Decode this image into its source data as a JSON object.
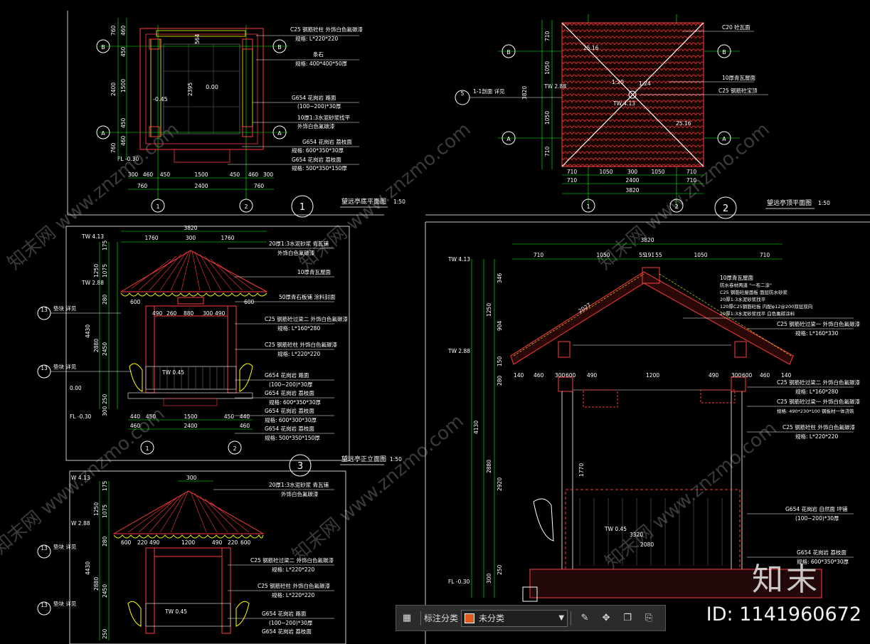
{
  "drawings": {
    "plan_base": {
      "title": "望远亭底平面图",
      "scale": "1:50",
      "number": "1",
      "grid_rows": [
        "B",
        "A"
      ],
      "grid_cols": [
        "1",
        "2"
      ],
      "dims_bottom_1": [
        "300",
        "460",
        "450",
        "1500",
        "450",
        "460",
        "300"
      ],
      "dims_bottom_2": [
        "760",
        "2400",
        "760"
      ],
      "dims_left": [
        "760",
        "460",
        "450",
        "1500",
        "2400",
        "450",
        "460",
        "760"
      ],
      "center_dims": [
        "2395",
        "564"
      ],
      "level_main": "0.00",
      "level_side": "-0.45",
      "level_fl": "FL -0.30",
      "notes": [
        "C25 钢筋砼柱  外饰白色氟碳漆",
        "规格: L*220*220",
        "条石",
        "规格: 400*400*50厚",
        "G654 花岗岩  路面",
        "(100~200)*30厚",
        "10厚1:3水泥砂浆找平",
        "外饰白色氟碳漆",
        "G654 花岗岩 荔枝面",
        "规格: 600*350*30厚",
        "G654 花岗岩 荔枝面",
        "规格: 500*350*150厚"
      ]
    },
    "plan_roof": {
      "title": "望远亭顶平面图",
      "scale": "1:50",
      "number": "2",
      "dims_bottom_1": [
        "710",
        "1050",
        "300",
        "1050",
        "710"
      ],
      "dims_bottom_2": [
        "710",
        "2400",
        "710"
      ],
      "dims_bottom_3": [
        "3820"
      ],
      "dims_left": [
        "710",
        "1050",
        "3820",
        "1050",
        "710"
      ],
      "level_tw_1": "TW 2.88",
      "level_tw_2": "TW 4.13",
      "diag_labels": [
        "25.16",
        "1:20",
        "1:24",
        "25.16"
      ],
      "notes": [
        "C20 砼瓦面",
        "10厚青瓦屋面",
        "C25 钢筋砼宝顶"
      ],
      "section_ref": "5",
      "section_ref_text": "1-1剖面  详见"
    },
    "elev_front": {
      "title": "望远亭正立面图",
      "scale": "1:50",
      "number": "3",
      "dims_top": [
        "3820",
        "1760",
        "300",
        "1760"
      ],
      "dims_inner": [
        "600",
        "490",
        "260",
        "880",
        "300",
        "490",
        "600"
      ],
      "dims_left": [
        "175",
        "1250",
        "1075",
        "280",
        "4430",
        "2880",
        "2450",
        "250",
        "300"
      ],
      "levels": [
        "TW 4.13",
        "TW 2.88",
        "0.00",
        "FL -0.30",
        "TW 0.45"
      ],
      "dims_bottom_1": [
        "440",
        "450",
        "1500",
        "450",
        "440"
      ],
      "dims_bottom_2": [
        "460",
        "2400",
        "460"
      ],
      "notes": [
        "20厚1:3水泥砂浆  青瓦铺",
        "外饰白色氟碳漆",
        "10厚青瓦屋面",
        "50厚青石板铺  涂料封面",
        "C25 钢筋砼过梁二  外饰白色氟碳漆",
        "规格: L*160*280",
        "C25 钢筋砼柱  外饰白色氟碳漆",
        "规格: L*220*220",
        "G654 花岗岩  路面",
        "(100~200)*30厚",
        "G654 花岗岩 荔枝面",
        "规格: 600*350*30厚",
        "G654 花岗岩 荔枝面",
        "规格: 600*300*30厚",
        "G654 花岗岩 荔枝面",
        "规格: 500*350*150厚"
      ],
      "ref_labels": [
        "13",
        "13"
      ],
      "ref_text": [
        "垫块 详见",
        "垫块 详见"
      ]
    },
    "elev_side": {
      "dims_top": [
        "300"
      ],
      "dims_inner": [
        "600",
        "220",
        "490",
        "1200",
        "490",
        "220",
        "600"
      ],
      "dims_left": [
        "175",
        "1250",
        "1075",
        "280",
        "4430",
        "2880",
        "2450",
        "250"
      ],
      "levels": [
        "W 4.13",
        "W 2.88",
        "TW 0.45"
      ],
      "notes": [
        "20厚1:3水泥砂浆  青瓦铺",
        "外饰白色氟碳漆",
        "C25 钢筋砼过梁二  外饰白色氟碳漆",
        "规格: L*220*220",
        "C25 钢筋砼柱  外饰白色氟碳漆",
        "规格: L*220*220",
        "G654 花岗岩  路面",
        "(100~200)*30厚",
        "G654 花岗岩 荔枝面"
      ]
    },
    "section": {
      "dims_top_1": [
        "3820"
      ],
      "dims_top_2": [
        "710",
        "1050",
        "55",
        "191",
        "55",
        "1050",
        "710"
      ],
      "dims_mid": [
        "140",
        "460",
        "300",
        "600",
        "490",
        "1200",
        "490",
        "300",
        "600",
        "460",
        "140"
      ],
      "dims_left": [
        "346",
        "1250",
        "904",
        "150",
        "280",
        "4130",
        "2880",
        "2920",
        "1770",
        "300",
        "250"
      ],
      "levels": [
        "TW 4.13",
        "TW 2.88",
        "FL -0.30",
        "TW 0.45"
      ],
      "inner_dims": [
        "3320",
        "2080",
        "2027"
      ],
      "notes": [
        "10厚青瓦屋面",
        "防水卷材两道 \"一布二涂\"",
        "C25 钢筋砼屋面板 面层防水砂浆",
        "20厚1:3水泥砂浆找平",
        "120厚C25钢筋砼板  内配φ12@200双层双向",
        "20厚1:3水泥砂浆找平  白色氟碳涂料",
        "C25 钢筋砼过梁一  外饰白色氟碳漆",
        "规格: L*160*330",
        "C25 钢筋砼过梁二  外饰白色氟碳漆",
        "规格: L*160*280",
        "C25 钢筋砼过梁一  外饰白色氟碳漆",
        "规格: 490*230*100 钢板材一体浇筑",
        "C25 钢筋砼柱  外饰白色氟碳漆",
        "规格: L*220*220",
        "G654 花岗岩 自然面  坪铺",
        "(100~200)*30厚",
        "G654 花岗岩 荔枝面",
        "规格: 600*350*30厚"
      ]
    }
  },
  "watermark": "知末网 www.znzmo.com",
  "toolbar": {
    "label": "标注分类",
    "selected": "未分类",
    "swatch_color": "#e05a1c",
    "icons": [
      "grid-icon",
      "edit-icon",
      "move-icon",
      "copy-icon",
      "paste-icon"
    ]
  },
  "brand": {
    "logo": "知末",
    "id_text": "ID: 1141960672"
  },
  "colors": {
    "background": "#000000",
    "grid_green": "#00ff00",
    "structure_red": "#ff3b3b",
    "tile_yellow": "#ffff00",
    "text_white": "#ffffff"
  }
}
